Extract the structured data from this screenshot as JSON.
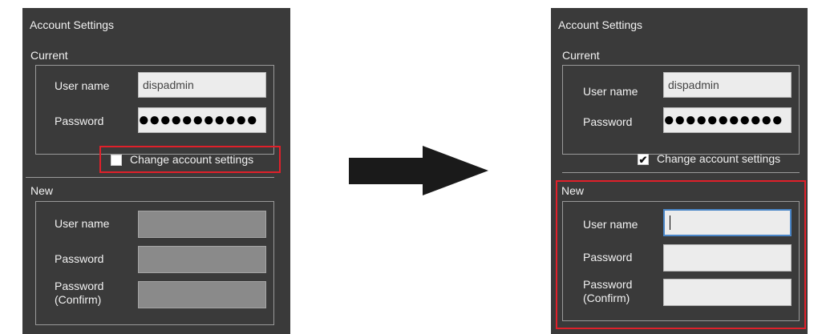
{
  "panel_title": "Account Settings",
  "current_group": "Current",
  "new_group": "New",
  "labels": {
    "user_name": "User name",
    "password": "Password",
    "password_confirm_1": "Password",
    "password_confirm_2": "(Confirm)"
  },
  "current": {
    "user_name_value": "dispadmin",
    "password_value": "●●●●●●●●●●●"
  },
  "change_account_label": "Change account settings",
  "before": {
    "change_checked": false,
    "new_fields_enabled": false
  },
  "after": {
    "change_checked": true,
    "new_fields_enabled": true,
    "check_mark": "✔"
  },
  "colors": {
    "panel_bg": "#3a3a3a",
    "highlight": "#e0202a",
    "arrow": "#1a1a1a",
    "focus_border": "#4a86c8"
  }
}
